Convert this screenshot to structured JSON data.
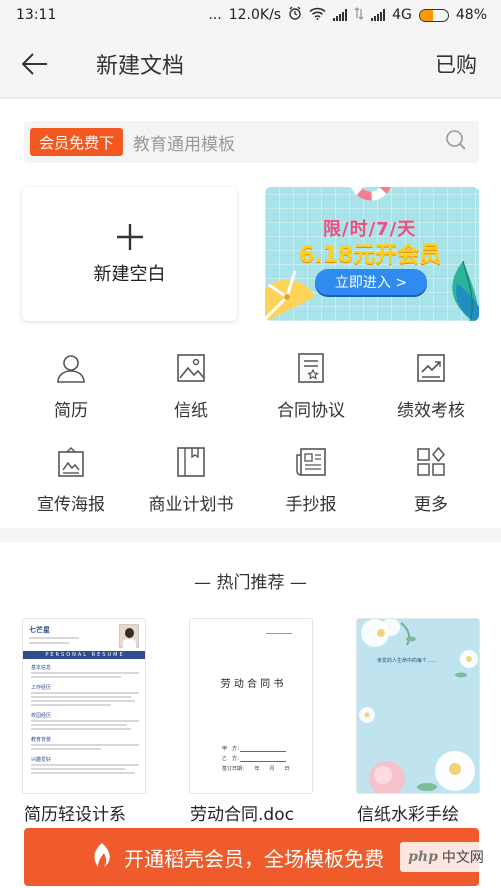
{
  "status_bar": {
    "time": "13:11",
    "dots": "...",
    "speed": "12.0K/s",
    "network": "4G",
    "battery": "48%",
    "battery_level": 0.48,
    "battery_color": "#ff9800"
  },
  "header": {
    "title": "新建文档",
    "right_action": "已购",
    "back_icon": "arrow-left-icon"
  },
  "search": {
    "tag": "会员免费下",
    "placeholder": "教育通用模板",
    "icon": "search-icon"
  },
  "new_blank": {
    "label": "新建空白",
    "icon": "plus-icon"
  },
  "promo_banner": {
    "line1": "限/时/7/天",
    "line2": "6.18元开会员",
    "cta": "立即进入 >"
  },
  "categories": [
    {
      "label": "简历",
      "icon": "person-icon"
    },
    {
      "label": "信纸",
      "icon": "picture-icon"
    },
    {
      "label": "合同协议",
      "icon": "contract-icon"
    },
    {
      "label": "绩效考核",
      "icon": "chart-icon"
    },
    {
      "label": "宣传海报",
      "icon": "poster-icon"
    },
    {
      "label": "商业计划书",
      "icon": "book-icon"
    },
    {
      "label": "手抄报",
      "icon": "newspaper-icon"
    },
    {
      "label": "更多",
      "icon": "grid-more-icon"
    }
  ],
  "hot": {
    "title": "— 热门推荐 —",
    "templates": [
      {
        "name": "简历轻设计系",
        "resume_name": "七芒星",
        "resume_banner": "PERSONAL RESUME",
        "resume_sections": [
          "基本信息",
          "工作经历",
          "校园经历",
          "教育背景",
          "兴趣爱好"
        ]
      },
      {
        "name": "劳动合同.doc",
        "doc_title": "劳 动 合 同 书",
        "doc_fields": [
          "甲　方：",
          "乙　方：",
          "签订日期：　　年　　月　　日"
        ]
      },
      {
        "name": "信纸水彩手绘",
        "letter_text": "亲爱的人生命中的每个……"
      }
    ]
  },
  "bottom_banner": {
    "text": "开通稻壳会员，全场模板免费",
    "icon": "flame-leaf-icon"
  },
  "watermark": {
    "php": "php",
    "cn": "中文网"
  },
  "colors": {
    "accent": "#ef5b2a",
    "tag": "#f2581f",
    "cta_blue": "#2f8bf0",
    "resume_blue": "#2d4d8f"
  }
}
